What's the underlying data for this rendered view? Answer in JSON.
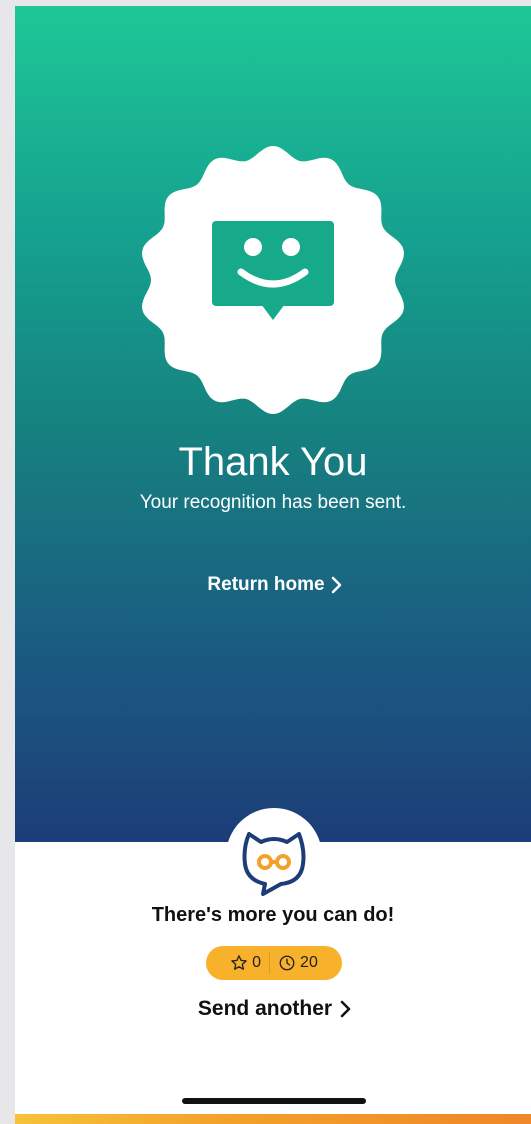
{
  "hero": {
    "title": "Thank You",
    "subtitle": "Your recognition has been sent.",
    "return_link": "Return home",
    "badge_icon": "smiley-message-icon"
  },
  "more": {
    "heading": "There's more you can do!",
    "stars_count": "0",
    "timer_count": "20",
    "send_link": "Send another",
    "logo_icon": "owl-logo-icon"
  },
  "colors": {
    "gradient_top": "#1ec796",
    "gradient_bottom": "#1c3d78",
    "pill": "#f8b12a",
    "bottom_bar": "#f3a12a"
  }
}
